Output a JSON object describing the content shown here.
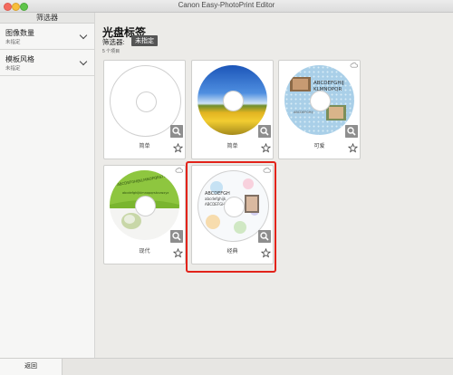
{
  "window": {
    "title": "Canon Easy-PhotoPrint Editor"
  },
  "sidebar": {
    "header": "筛选器",
    "filters": [
      {
        "title": "图像数量",
        "value": "未指定"
      },
      {
        "title": "模板风格",
        "value": "未指定"
      }
    ]
  },
  "main": {
    "title": "光盘标签",
    "filter_label": "筛选器:",
    "filter_badge": "未指定",
    "item_count": "5 个项目",
    "cards": [
      {
        "label": "简单",
        "selected": false
      },
      {
        "label": "简单",
        "selected": false
      },
      {
        "label": "可爱",
        "selected": false
      },
      {
        "label": "现代",
        "selected": false
      },
      {
        "label": "经典",
        "selected": true
      }
    ],
    "card_text": {
      "cute_line1": "ABCDEFGHIJ",
      "cute_line2": "KLMNOPQR",
      "modern_arc": "ABCDEFGHIJKLMNOPQRSTUVWXYZ",
      "modern_line": "abcdefghijklmnopqrstuvwxyz",
      "classic_line1": "ABCDEFGH",
      "classic_line2": "abcdefghijk",
      "classic_line3": "ABCDEFGHIJK"
    }
  },
  "footer": {
    "back_label": "返回"
  },
  "colors": {
    "selection": "#e2231a",
    "badge": "#555555",
    "modern_green": "#8ec63f"
  }
}
